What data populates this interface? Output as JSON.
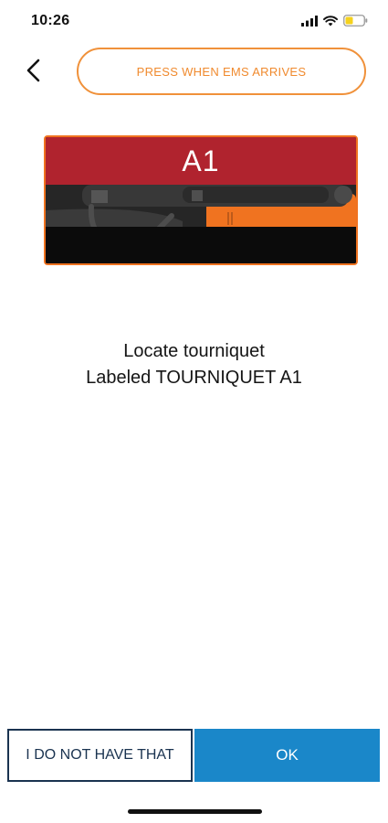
{
  "status_bar": {
    "time": "10:26",
    "icons": [
      "signal-icon",
      "wifi-icon",
      "battery-icon"
    ],
    "battery_color": "#f5d21e"
  },
  "header": {
    "back_icon": "back-arrow-icon",
    "ems_button_label": "PRESS WHEN EMS ARRIVES",
    "accent_color": "#f0913a"
  },
  "kit_image": {
    "label": "A1",
    "label_bar_color": "#b0232e",
    "orange_color": "#f07320"
  },
  "instruction": {
    "line1": "Locate tourniquet",
    "line2": "Labeled TOURNIQUET A1"
  },
  "footer": {
    "secondary_button_label": "I DO NOT HAVE THAT",
    "primary_button_label": "OK",
    "primary_color": "#1a87c9"
  }
}
